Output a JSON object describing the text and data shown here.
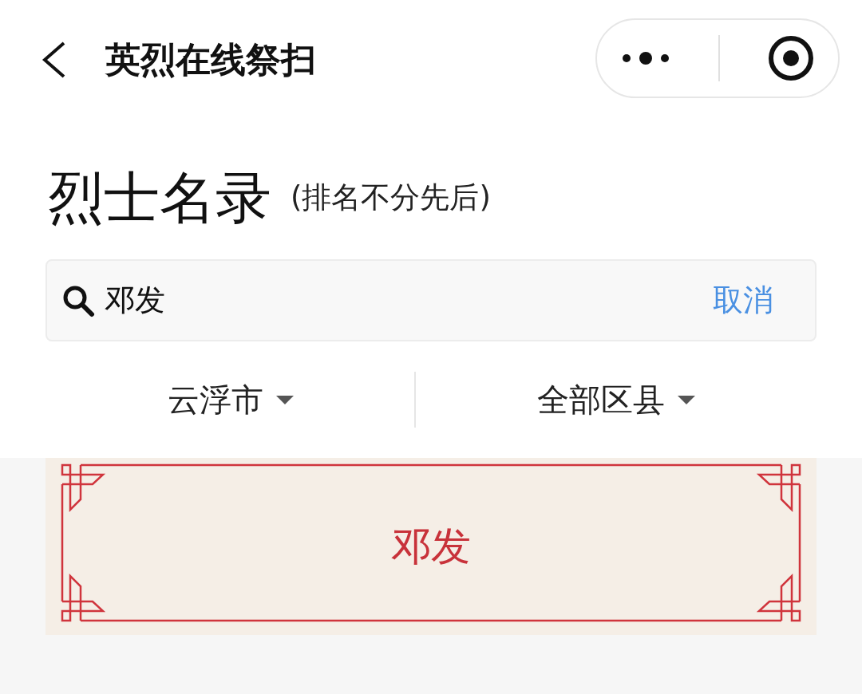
{
  "nav": {
    "title": "英烈在线祭扫"
  },
  "heading": {
    "title": "烈士名录",
    "subtitle": "(排名不分先后)"
  },
  "search": {
    "value": "邓发",
    "cancel": "取消"
  },
  "filters": [
    {
      "label": "云浮市"
    },
    {
      "label": "全部区县"
    }
  ],
  "results": [
    {
      "name": "邓发"
    }
  ]
}
